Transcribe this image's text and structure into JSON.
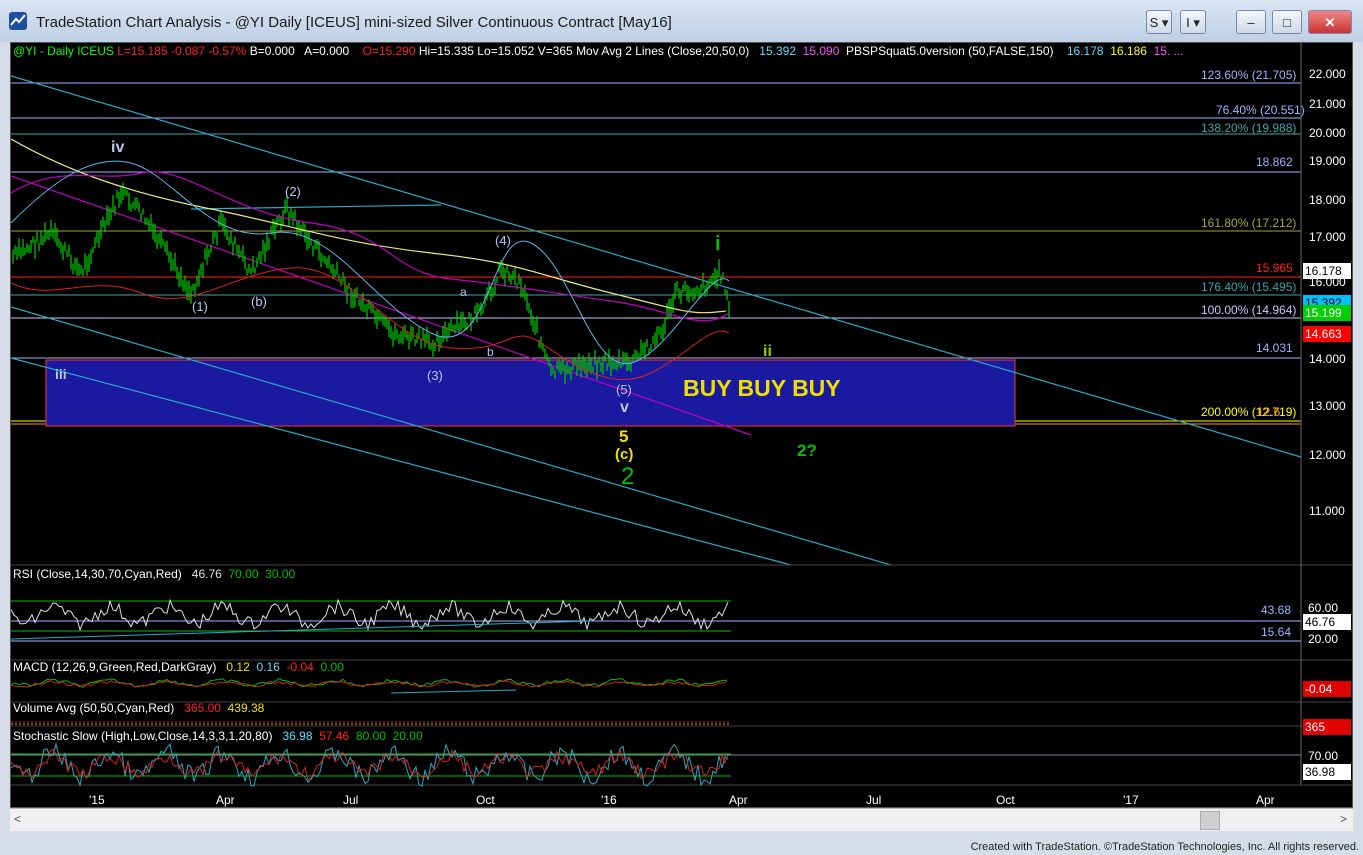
{
  "window": {
    "title": "TradeStation Chart Analysis - @YI Daily [ICEUS] mini-sized Silver Continuous Contract [May16]",
    "buttons": {
      "s": "S",
      "i": "I"
    }
  },
  "header": {
    "symbol": "@YI - Daily  ICEUS",
    "last": "L=15.185",
    "change": "-0.087",
    "pct": "-0.57%",
    "bid": "B=0.000",
    "ask": "A=0.000",
    "open": "O=15.290",
    "high": "Hi=15.335",
    "low": "Lo=15.052",
    "volume": "V=365",
    "ma_label": "Mov Avg 2 Lines (Close,20,50,0)",
    "ma1": "15.392",
    "ma2": "15.090",
    "pbs_label": "PBSPSquat5.0version (50,FALSE,150)",
    "pbs1": "16.178",
    "pbs2": "16.186",
    "pbs3": "15.",
    "more": "..."
  },
  "price_axis": {
    "ticks": [
      "22.000",
      "21.000",
      "20.000",
      "19.000",
      "18.000",
      "17.000",
      "16.000",
      "15.000",
      "14.000",
      "13.000",
      "12.000",
      "11.000"
    ],
    "right_badges": [
      {
        "text": "16.178",
        "bg": "#ffffff",
        "fg": "#000000"
      },
      {
        "text": "15.392",
        "bg": "#00c0ff",
        "fg": "#000000"
      },
      {
        "text": "15.199",
        "bg": "#00d000",
        "fg": "#ffffff"
      },
      {
        "text": "14.663",
        "bg": "#ff0000",
        "fg": "#ffffff"
      }
    ]
  },
  "levels": [
    {
      "text": "123.60% (21.705)",
      "color": "#9fb4ff"
    },
    {
      "text": "76.40% (20.551)",
      "color": "#9fb4ff"
    },
    {
      "text": "138.20% (19.988)",
      "color": "#3aa6a6"
    },
    {
      "text": "18.862",
      "color": "#9fb4ff"
    },
    {
      "text": "161.80% (17.212)",
      "color": "#a5a532"
    },
    {
      "text": "15.965",
      "color": "#ff2020"
    },
    {
      "text": "176.40% (15.495)",
      "color": "#3aa6a6"
    },
    {
      "text": "100.00% (14.964)",
      "color": "#c8c8ff"
    },
    {
      "text": "14.031",
      "color": "#9fb4ff"
    },
    {
      "text": "200.00% (12.719)",
      "color": "#ffff00"
    },
    {
      "text": "12.6",
      "color": "#ff9900"
    }
  ],
  "wave_labels": {
    "iv": "iv",
    "iii": "iii",
    "w1": "(1)",
    "wb": "(b)",
    "w2": "(2)",
    "w3": "(3)",
    "w4": "(4)",
    "w5": "(5)",
    "a": "a",
    "b": "b",
    "v": "v",
    "five": "5",
    "c": "(c)",
    "two": "2",
    "i": "i",
    "ii": "ii",
    "two_q": "2?"
  },
  "box_text": "BUY BUY BUY",
  "rsi": {
    "label": "RSI (Close,14,30,70,Cyan,Red)",
    "v1": "46.76",
    "v2": "70.00",
    "v3": "30.00",
    "lv1": "43.68",
    "lv2": "15.64",
    "ticks": [
      "60.00",
      "20.00"
    ],
    "badge": "46.76"
  },
  "macd": {
    "label": "MACD (12,26,9,Green,Red,DarkGray)",
    "v1": "0.12",
    "v2": "0.16",
    "v3": "-0.04",
    "v4": "0.00",
    "badge": "-0.04"
  },
  "volume": {
    "label": "Volume Avg (50,50,Cyan,Red)",
    "v1": "365.00",
    "v2": "439.38",
    "badge": "365"
  },
  "stoch": {
    "label": "Stochastic Slow (High,Low,Close,14,3,3,1,20,80)",
    "v1": "36.98",
    "v2": "57.46",
    "v3": "80.00",
    "v4": "20.00",
    "tick": "70.00",
    "badge": "36.98"
  },
  "x_axis": [
    "'15",
    "Apr",
    "Jul",
    "Oct",
    "'16",
    "Apr",
    "Jul",
    "Oct",
    "'17",
    "Apr"
  ],
  "status": "Created with TradeStation. ©TradeStation Technologies, Inc. All rights reserved."
}
